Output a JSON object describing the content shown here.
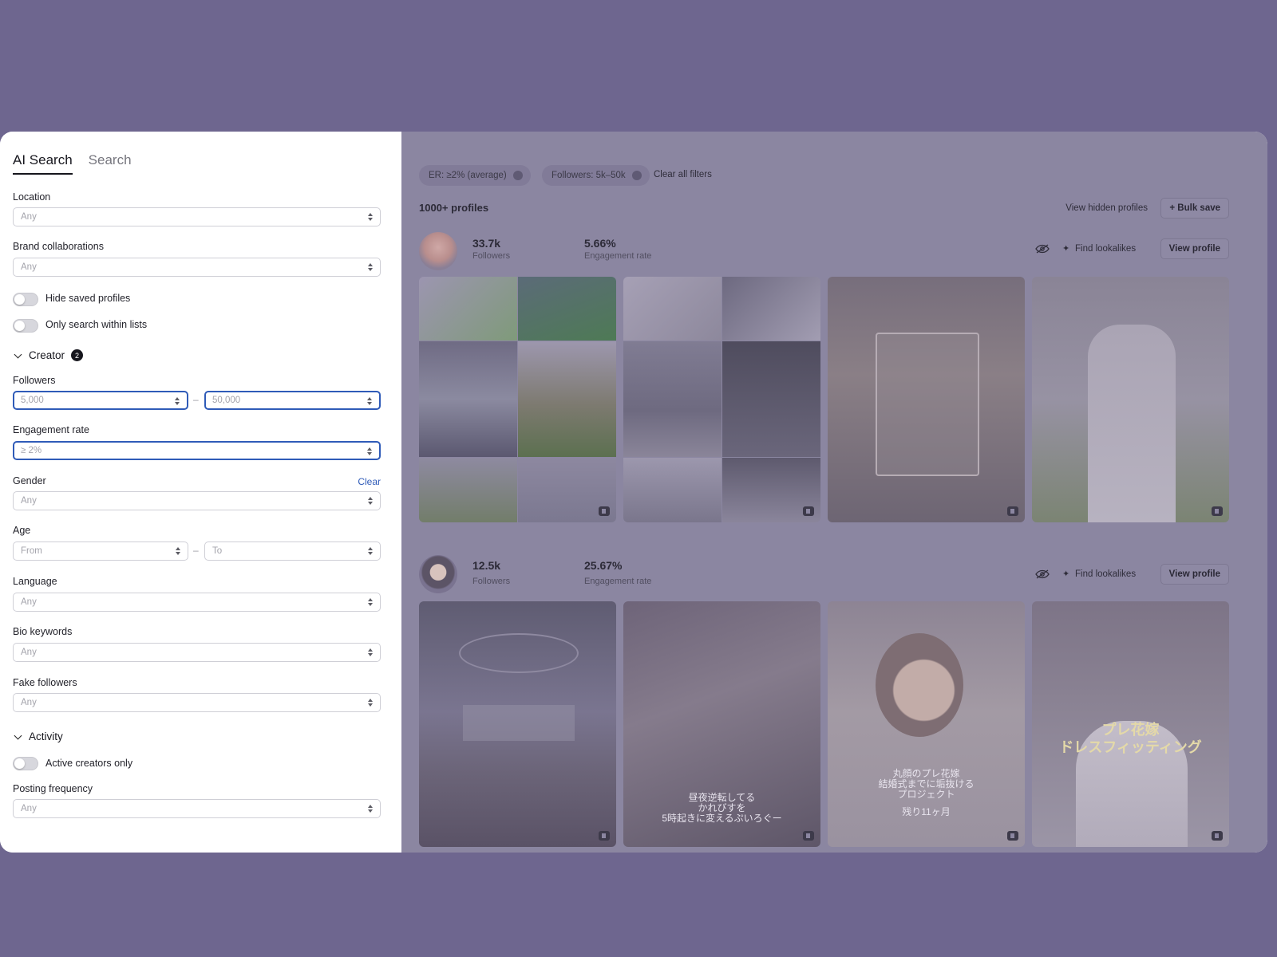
{
  "tabs": [
    {
      "label": "AI Search",
      "active": true
    },
    {
      "label": "Search",
      "active": false
    }
  ],
  "filters": {
    "location": {
      "label": "Location",
      "placeholder": "Any"
    },
    "brand_collaborations": {
      "label": "Brand collaborations",
      "placeholder": "Any"
    },
    "hide_saved": {
      "label": "Hide saved profiles",
      "on": false
    },
    "only_lists": {
      "label": "Only search within lists",
      "on": false
    },
    "creator_section": {
      "label": "Creator",
      "badge": "2"
    },
    "followers": {
      "label": "Followers",
      "min_placeholder": "5,000",
      "max_placeholder": "50,000",
      "separator": "–"
    },
    "engagement_rate": {
      "label": "Engagement rate",
      "placeholder": "≥ 2%"
    },
    "gender": {
      "label": "Gender",
      "placeholder": "Any",
      "clear_label": "Clear"
    },
    "age": {
      "label": "Age",
      "from_placeholder": "From",
      "to_placeholder": "To",
      "separator": "–"
    },
    "language": {
      "label": "Language",
      "placeholder": "Any"
    },
    "bio_keywords": {
      "label": "Bio keywords",
      "placeholder": "Any"
    },
    "fake_followers": {
      "label": "Fake followers",
      "placeholder": "Any"
    },
    "activity_section": {
      "label": "Activity"
    },
    "active_only": {
      "label": "Active creators only",
      "on": false
    },
    "posting_frequency": {
      "label": "Posting frequency",
      "placeholder": "Any"
    }
  },
  "results": {
    "chips": [
      {
        "label": "ER: ≥2% (average)"
      },
      {
        "label": "Followers: 5k–50k"
      }
    ],
    "clear_all_label": "Clear all filters",
    "count_label": "1000+ profiles",
    "view_hidden_label": "View hidden profiles",
    "bulk_save_label": "+ Bulk save",
    "profiles": [
      {
        "followers": "33.7k",
        "followers_label": "Followers",
        "engagement": "5.66%",
        "engagement_label": "Engagement rate",
        "find_lookalikes_label": "Find lookalikes",
        "view_profile_label": "View profile"
      },
      {
        "followers": "12.5k",
        "followers_label": "Followers",
        "engagement": "25.67%",
        "engagement_label": "Engagement rate",
        "find_lookalikes_label": "Find lookalikes",
        "view_profile_label": "View profile",
        "captions": {
          "post2": [
            "昼夜逆転してる",
            "かれびすを",
            "5時起きに変えるぷいろぐー"
          ],
          "post3": [
            "丸顔のプレ花嫁",
            "結婚式までに垢抜ける",
            "プロジェクト",
            "残り11ヶ月"
          ],
          "post4": [
            "プレ花嫁",
            "ドレスフィッティング"
          ]
        }
      }
    ]
  },
  "colors": {
    "backdrop": "#6e668f",
    "accent": "#2f5bb8",
    "overlay": "#8b86a1"
  }
}
